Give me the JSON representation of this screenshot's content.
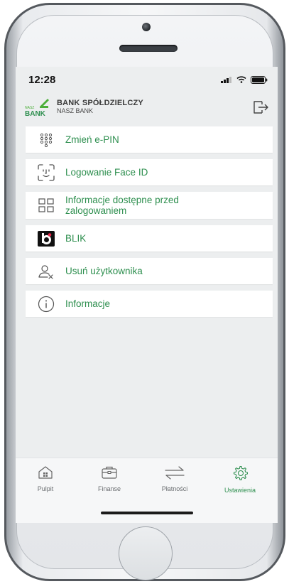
{
  "status_bar": {
    "time": "12:28"
  },
  "header": {
    "logo_text_top": "NASZ",
    "logo_text_main": "BANK",
    "bank_name": "BANK SPÓŁDZIELCZY",
    "bank_subname": "NASZ BANK"
  },
  "menu": {
    "items": [
      {
        "label": "Zmień e-PIN",
        "icon": "keypad-icon"
      },
      {
        "label": "Logowanie Face ID",
        "icon": "face-id-icon"
      },
      {
        "label": "Informacje dostępne przed zalogowaniem",
        "icon": "grid-icon"
      },
      {
        "label": "BLIK",
        "icon": "blik-icon"
      },
      {
        "label": "Usuń użytkownika",
        "icon": "remove-user-icon"
      },
      {
        "label": "Informacje",
        "icon": "info-icon"
      }
    ]
  },
  "tabbar": {
    "items": [
      {
        "label": "Pulpit",
        "icon": "home-icon"
      },
      {
        "label": "Finanse",
        "icon": "wallet-icon"
      },
      {
        "label": "Płatności",
        "icon": "transfer-icon"
      },
      {
        "label": "Ustawienia",
        "icon": "gear-icon",
        "active": true
      }
    ]
  },
  "colors": {
    "accent": "#2e8f4f",
    "logo_green": "#4caf3a"
  }
}
